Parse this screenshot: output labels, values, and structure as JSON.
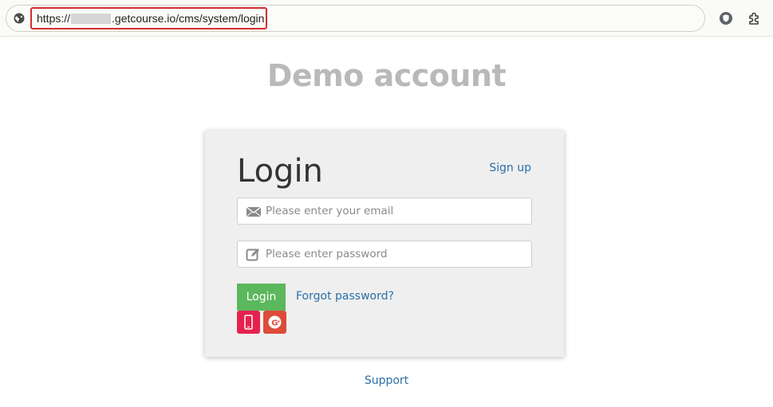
{
  "browser": {
    "url_prefix": "https://",
    "url_suffix": ".getcourse.io/cms/system/login",
    "site_icon": "globe-icon",
    "extensions": [
      "shield-extension-icon",
      "puzzle-extensions-icon"
    ]
  },
  "page": {
    "title": "Demo account",
    "support_label": "Support"
  },
  "login_form": {
    "heading": "Login",
    "signup_label": "Sign up",
    "email_placeholder": "Please enter your email",
    "email_icon": "envelope-icon",
    "password_placeholder": "Please enter password",
    "password_icon": "edit-icon",
    "login_button_label": "Login",
    "forgot_label": "Forgot password?",
    "social": [
      {
        "name": "phone",
        "icon": "phone-icon",
        "color": "#e5224f"
      },
      {
        "name": "google-plus",
        "icon": "google-plus-icon",
        "color": "#dd4b39"
      }
    ]
  },
  "colors": {
    "accent_link": "#2a6fa8",
    "login_button": "#5cb85c",
    "highlight_border": "#d32f2f"
  }
}
